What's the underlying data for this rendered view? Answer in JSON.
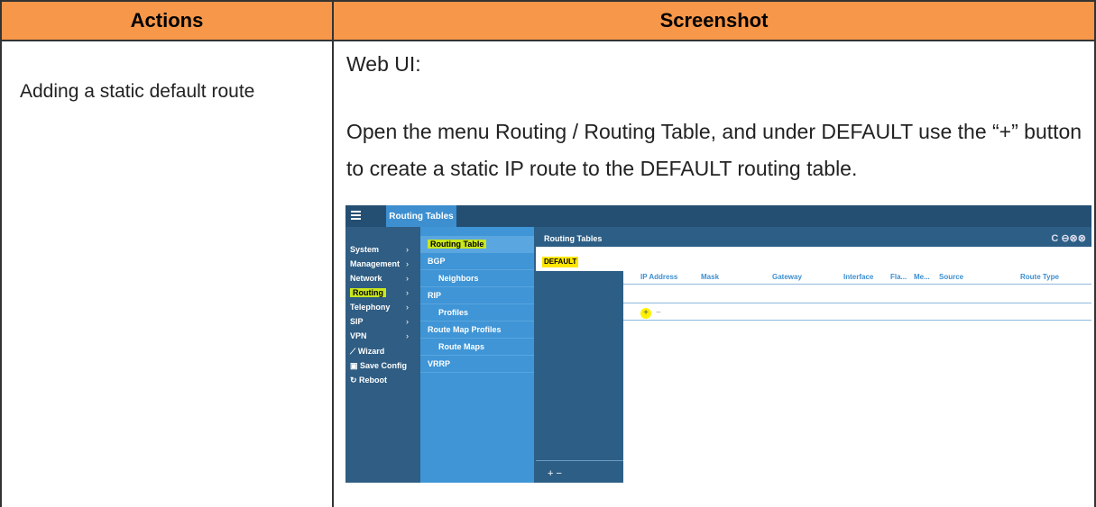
{
  "table": {
    "headers": [
      "Actions",
      "Screenshot"
    ],
    "action": "Adding a static default route",
    "webui_label": "Web UI:",
    "instruction": "Open the menu Routing / Routing Table, and under DEFAULT use the “+” button to create a static IP route to the DEFAULT routing table."
  },
  "screenshot": {
    "top_tab": "Routing Tables",
    "nav_primary": [
      {
        "label": "System",
        "chevron": "›"
      },
      {
        "label": "Management",
        "chevron": "›"
      },
      {
        "label": "Network",
        "chevron": "›"
      },
      {
        "label": "Routing",
        "chevron": "›"
      },
      {
        "label": "Telephony",
        "chevron": "›"
      },
      {
        "label": "SIP",
        "chevron": "›"
      },
      {
        "label": "VPN",
        "chevron": "›"
      },
      {
        "label": "Wizard",
        "chevron": ""
      },
      {
        "label": "Save Config",
        "chevron": ""
      },
      {
        "label": "Reboot",
        "chevron": ""
      }
    ],
    "nav_secondary": [
      {
        "label": "Routing Table"
      },
      {
        "label": "BGP"
      },
      {
        "label": "Neighbors"
      },
      {
        "label": "RIP"
      },
      {
        "label": "Profiles"
      },
      {
        "label": "Route Map Profiles"
      },
      {
        "label": "Route Maps"
      },
      {
        "label": "VRRP"
      }
    ],
    "panel_title": "Routing Tables",
    "panel_controls": "C ⊖⊗⊗",
    "default_label": "DEFAULT",
    "columns": [
      "IP Address",
      "Mask",
      "Gateway",
      "Interface",
      "Fla...",
      "Me...",
      "Source",
      "Route Type"
    ],
    "add_button": "+",
    "remove_button": "−",
    "list_controls": "+   −",
    "icons": {
      "menu": "hamburger-icon",
      "wizard": "wand-icon",
      "save": "floppy-icon",
      "reboot": "refresh-icon"
    },
    "colors": {
      "header_orange": "#f6974a",
      "highlight_yellow": "#f2f200",
      "highlight_green": "#c8e61e",
      "nav_dark": "#2f5d83",
      "nav_light": "#3f95d6"
    }
  }
}
